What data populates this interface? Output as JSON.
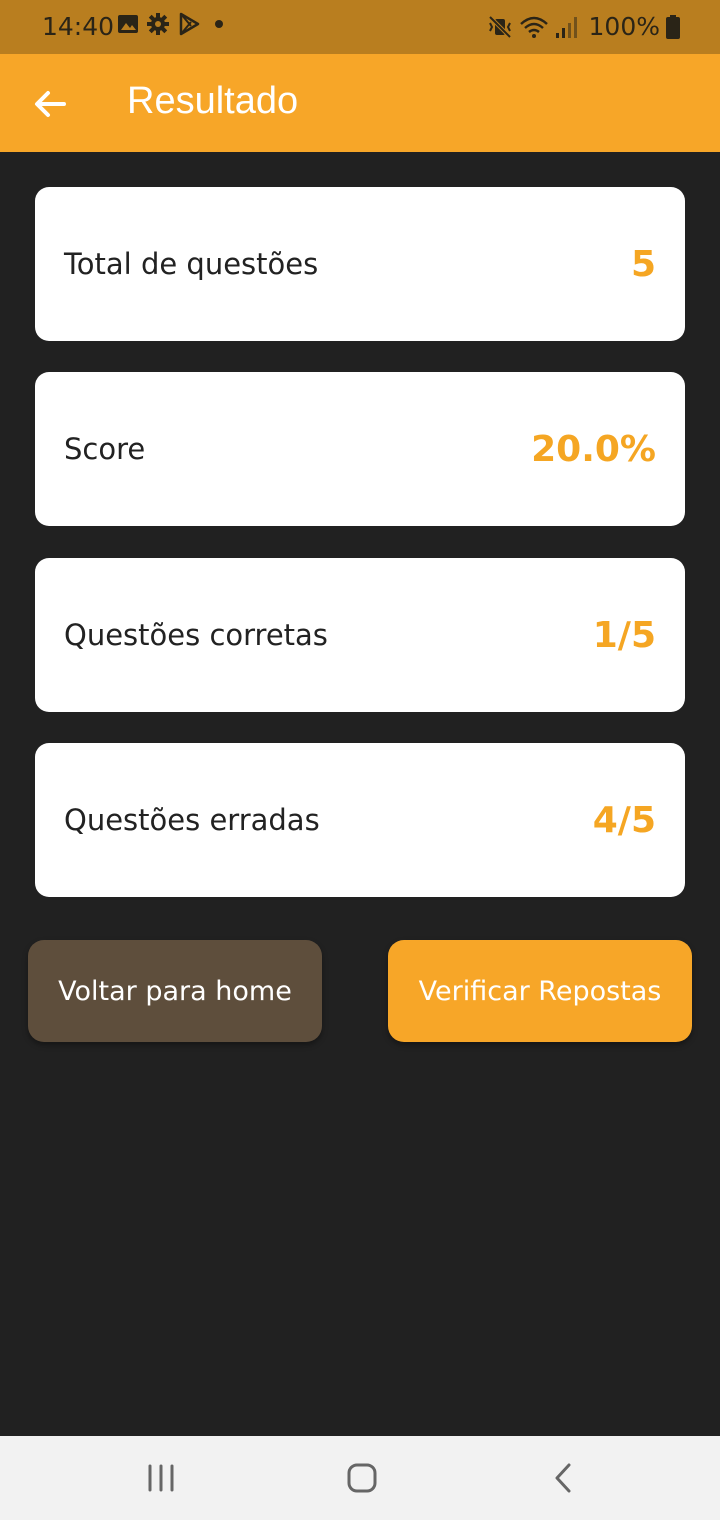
{
  "status_bar": {
    "time": "14:40",
    "battery": "100%",
    "icons": [
      "gallery-icon",
      "settings-gear-icon",
      "play-store-icon",
      "dot-icon",
      "mute-vibrate-icon",
      "wifi-icon",
      "signal-icon",
      "battery-icon"
    ]
  },
  "app_bar": {
    "title": "Resultado",
    "back_icon": "arrow-back-icon",
    "color": "#f7a628"
  },
  "results": [
    {
      "label": "Total de questões",
      "value": "5"
    },
    {
      "label": "Score",
      "value": "20.0%"
    },
    {
      "label": "Questões corretas",
      "value": "1/5"
    },
    {
      "label": "Questões erradas",
      "value": "4/5"
    }
  ],
  "buttons": {
    "home_label": "Voltar para home",
    "verify_label": "Verificar Repostas"
  },
  "nav_bar": {
    "icons": [
      "recent-apps-icon",
      "home-icon",
      "back-chevron-icon"
    ]
  },
  "colors": {
    "accent": "#f5a623",
    "background": "#212121",
    "home_button": "#5e4e3c",
    "status_bar": "#b97e1f"
  }
}
